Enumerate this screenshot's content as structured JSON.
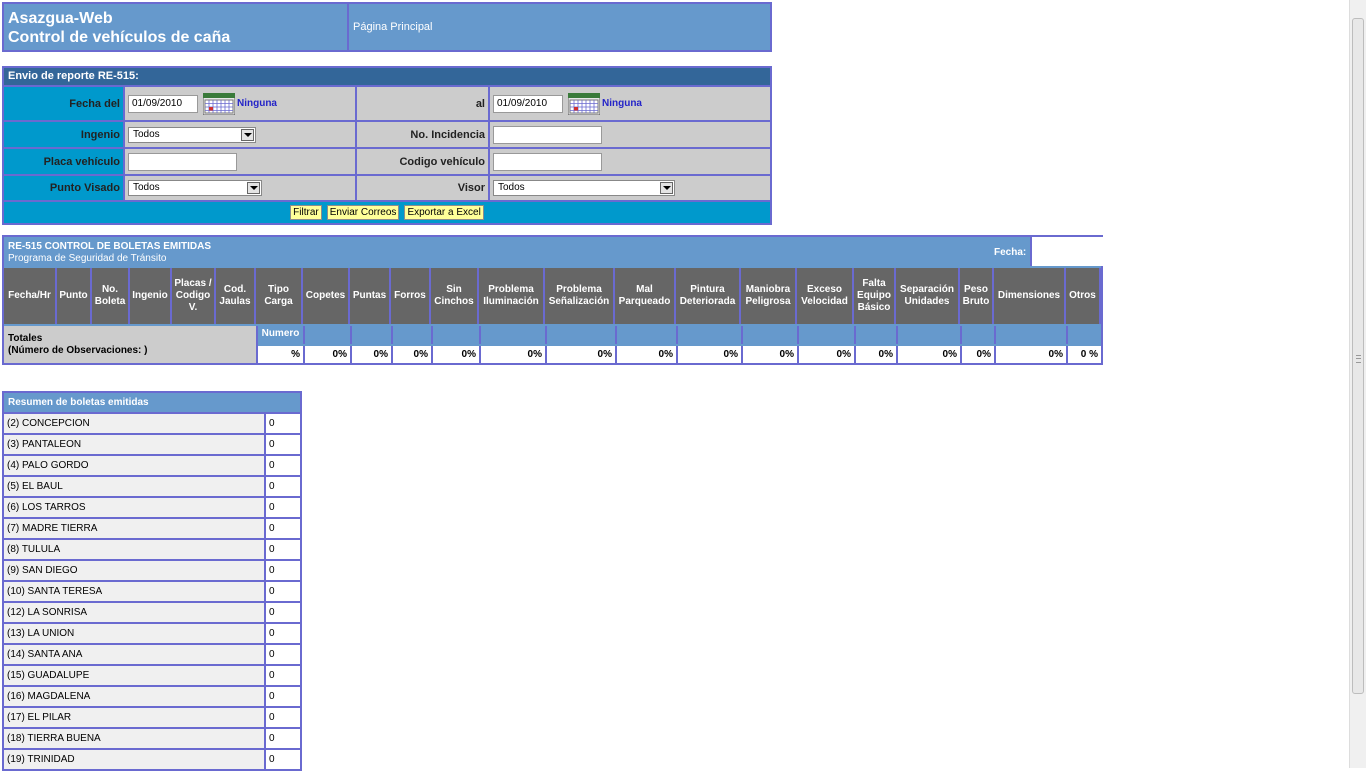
{
  "header": {
    "app_name": "Asazgua-Web",
    "app_subtitle": "Control de vehículos de caña",
    "nav_link": "Página Principal"
  },
  "filter": {
    "title": "Envio de reporte RE-515:",
    "fecha_del_label": "Fecha del",
    "fecha_del_value": "01/09/2010",
    "fecha_al_label": "al",
    "fecha_al_value": "01/09/2010",
    "ninguna_label": "Ninguna",
    "ingenio_label": "Ingenio",
    "ingenio_value": "Todos",
    "incidencia_label": "No. Incidencia",
    "placa_label": "Placa vehículo",
    "codigo_label": "Codigo vehículo",
    "punto_label": "Punto Visado",
    "punto_value": "Todos",
    "visor_label": "Visor",
    "visor_value": "Todos",
    "buttons": {
      "filtrar": "Filtrar",
      "enviar": "Enviar Correos",
      "exportar": "Exportar a Excel"
    }
  },
  "report": {
    "title": "RE-515 CONTROL DE BOLETAS EMITIDAS",
    "subtitle": "Programa de Seguridad de Tránsito",
    "fecha_label": "Fecha:",
    "columns": [
      "Fecha/Hr",
      "Punto",
      "No. Boleta",
      "Ingenio",
      "Placas / Codigo V.",
      "Cod. Jaulas",
      "Tipo Carga",
      "Copetes",
      "Puntas",
      "Forros",
      "Sin Cinchos",
      "Problema Iluminación",
      "Problema Señalización",
      "Mal Parqueado",
      "Pintura Deteriorada",
      "Maniobra Peligrosa",
      "Exceso Velocidad",
      "Falta Equipo Básico",
      "Separación Unidades",
      "Peso Bruto",
      "Dimensiones",
      "Otros"
    ],
    "totals_label": "Totales",
    "totals_obs": "(Número de Observaciones: )",
    "numero_label": "Numero",
    "percents": [
      "%",
      "0%",
      "0%",
      "0%",
      "0%",
      "0%",
      "0%",
      "0%",
      "0%",
      "0%",
      "0%",
      "0%",
      "0%",
      "0%",
      "0%",
      "0 %"
    ]
  },
  "summary": {
    "title": "Resumen de boletas emitidas",
    "rows": [
      {
        "name": "(2) CONCEPCION",
        "value": "0"
      },
      {
        "name": "(3) PANTALEON",
        "value": "0"
      },
      {
        "name": "(4) PALO GORDO",
        "value": "0"
      },
      {
        "name": "(5) EL BAUL",
        "value": "0"
      },
      {
        "name": "(6) LOS TARROS",
        "value": "0"
      },
      {
        "name": "(7) MADRE TIERRA",
        "value": "0"
      },
      {
        "name": "(8) TULULA",
        "value": "0"
      },
      {
        "name": "(9) SAN DIEGO",
        "value": "0"
      },
      {
        "name": "(10) SANTA TERESA",
        "value": "0"
      },
      {
        "name": "(12) LA SONRISA",
        "value": "0"
      },
      {
        "name": "(13) LA UNION",
        "value": "0"
      },
      {
        "name": "(14) SANTA ANA",
        "value": "0"
      },
      {
        "name": "(15) GUADALUPE",
        "value": "0"
      },
      {
        "name": "(16) MAGDALENA",
        "value": "0"
      },
      {
        "name": "(17) EL PILAR",
        "value": "0"
      },
      {
        "name": "(18) TIERRA BUENA",
        "value": "0"
      },
      {
        "name": "(19) TRINIDAD",
        "value": "0"
      }
    ]
  },
  "icons": {
    "calendar": "calendar-icon",
    "dropdown": "chevron-down-icon"
  },
  "colors": {
    "header_bg": "#6699cc",
    "filter_bg": "#0099cc",
    "border": "#6a6ad0",
    "column_header": "#666666",
    "button": "#ffff99",
    "link": "#2424c8"
  }
}
